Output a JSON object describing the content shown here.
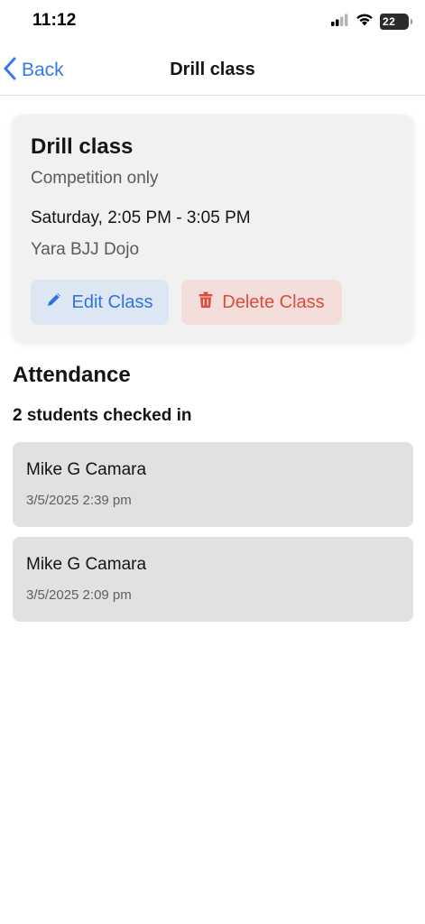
{
  "status_bar": {
    "time": "11:12",
    "battery": "22"
  },
  "nav": {
    "back_label": "Back",
    "title": "Drill class",
    "accent_color": "#3478f6"
  },
  "class_card": {
    "title": "Drill class",
    "subtitle": "Competition only",
    "schedule": "Saturday, 2:05 PM - 3:05 PM",
    "location": "Yara BJJ Dojo",
    "edit_label": "Edit Class",
    "delete_label": "Delete Class",
    "edit_icon": "pencil-icon",
    "delete_icon": "trash-icon"
  },
  "attendance": {
    "title": "Attendance",
    "count_text": "2 students checked in",
    "students": [
      {
        "name": "Mike G Camara",
        "checked_in": "3/5/2025 2:39 pm"
      },
      {
        "name": "Mike G Camara",
        "checked_in": "3/5/2025 2:09 pm"
      }
    ]
  }
}
